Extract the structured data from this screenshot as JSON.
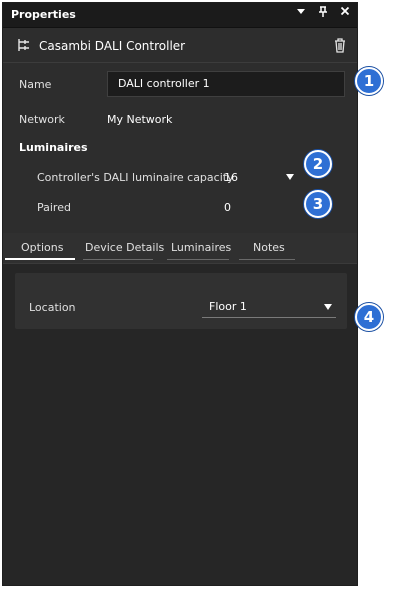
{
  "window": {
    "title": "Properties",
    "icons": [
      "dropdown-caret-icon",
      "pin-icon",
      "close-icon"
    ]
  },
  "header": {
    "title": "Casambi DALI Controller",
    "icon": "controller-icon",
    "delete_icon": "trash-icon"
  },
  "fields": {
    "name_label": "Name",
    "name_value": "DALI controller 1",
    "network_label": "Network",
    "network_value": "My Network"
  },
  "luminaires": {
    "title": "Luminaires",
    "capacity_label": "Controller's DALI luminaire capacity",
    "capacity_value": "16",
    "paired_label": "Paired",
    "paired_value": "0"
  },
  "tabs": [
    {
      "label": "Options",
      "active": true
    },
    {
      "label": "Device Details",
      "active": false
    },
    {
      "label": "Luminaires",
      "active": false
    },
    {
      "label": "Notes",
      "active": false
    }
  ],
  "options": {
    "location_label": "Location",
    "location_value": "Floor 1"
  },
  "callouts": [
    "1",
    "2",
    "3",
    "4"
  ],
  "colors": {
    "panel_bg": "#2d2d2d",
    "titlebar_bg": "#1b1b1b",
    "callout_blue": "#2e6fd4"
  }
}
